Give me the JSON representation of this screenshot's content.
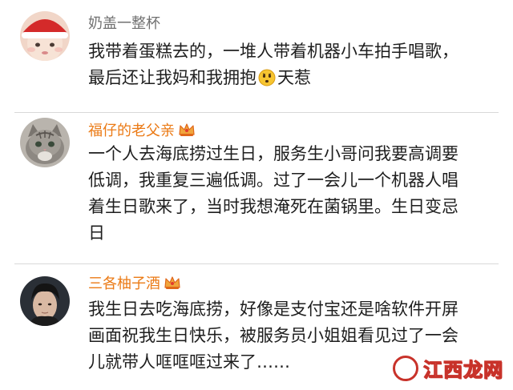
{
  "comments": [
    {
      "username": "奶盖一整杯",
      "lines": [
        "我带着蛋糕去的，一堆人带着机器小车拍手唱歌，",
        "最后还让我妈和我拥抱"
      ],
      "line_end": "天惹",
      "emoji": "confused-face-emoji"
    },
    {
      "username": "福仔的老父亲",
      "badge": "crown-badge",
      "lines": [
        "一个人去海底捞过生日，服务生小哥问我要高调要",
        "低调，我重复三遍低调。过了一会儿一个机器人唱",
        "着生日歌来了，当时我想淹死在菌锅里。生日变忌",
        "日"
      ]
    },
    {
      "username": "三各柚子酒",
      "badge": "crown-badge",
      "lines": [
        "我生日去吃海底捞，好像是支付宝还是啥软件开屏",
        "画面祝我生日快乐，被服务员小姐姐看见过了一会",
        "儿就带人哐哐哐过来了……"
      ]
    }
  ],
  "watermark": {
    "text": "江西龙网"
  },
  "colors": {
    "vip_name": "#eb7a15",
    "plain_name": "#707070",
    "body_text": "#1e1e1e",
    "divider": "#d9d9d9",
    "watermark": "#c8322a"
  }
}
